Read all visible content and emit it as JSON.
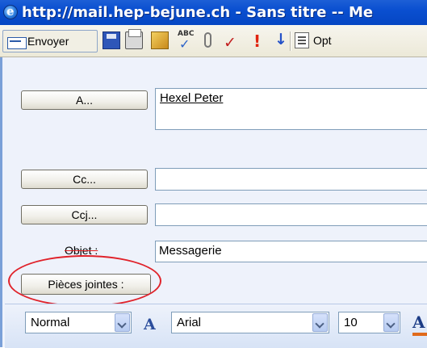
{
  "window": {
    "title": "http://mail.hep-bejune.ch - Sans titre -- Me",
    "icon": "ie-icon"
  },
  "toolbar": {
    "send_label": "Envoyer",
    "options_label": "Opt",
    "icons": [
      "save-icon",
      "print-icon",
      "edit-icon",
      "spellcheck-icon",
      "attach-icon",
      "check-names-icon",
      "importance-high-icon",
      "importance-low-icon",
      "options-icon"
    ]
  },
  "compose": {
    "to_button": "A...",
    "to_value": "Hexel Peter",
    "cc_button": "Cc...",
    "bcc_button": "Ccj...",
    "subject_label": "Objet :",
    "subject_value": "Messagerie",
    "attachments_button": "Pièces jointes :"
  },
  "format_bar": {
    "style_value": "Normal",
    "font_value": "Arial",
    "size_value": "10"
  },
  "colors": {
    "titlebar": "#0a4fd0",
    "annotation_ring": "#e0222a",
    "font_color_swatch": "#e06a1b"
  }
}
